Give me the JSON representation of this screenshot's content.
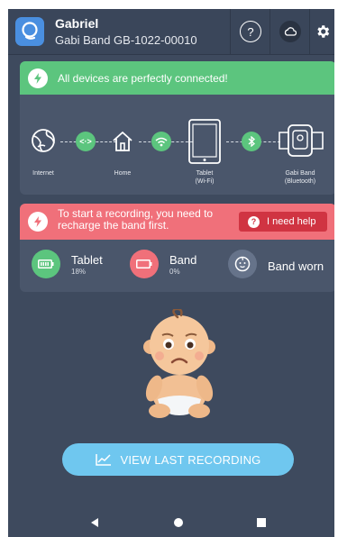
{
  "header": {
    "user_name": "Gabriel",
    "device_name": "Gabi Band GB-1022-00010",
    "help_icon": "question-circle-icon",
    "cloud_icon": "cloud-icon",
    "settings_icon": "gear-icon"
  },
  "connection": {
    "banner_text": "All devices are perfectly connected!",
    "nodes": [
      {
        "label": "Internet",
        "icon": "globe-icon"
      },
      {
        "label": "Home",
        "icon": "home-icon"
      },
      {
        "label": "Tablet\n(Wi-Fi)",
        "icon": "tablet-icon"
      },
      {
        "label": "Gabi Band\n(Bluetooth)",
        "icon": "band-icon"
      }
    ],
    "links": [
      "code-link-icon",
      "wifi-icon",
      "bluetooth-icon"
    ]
  },
  "status": {
    "banner_text": "To start a recording, you need to recharge the band first.",
    "help_button": "I need help",
    "tablet": {
      "label": "Tablet",
      "value": "18%"
    },
    "band": {
      "label": "Band",
      "value": "0%"
    },
    "worn": {
      "label": "Band worn"
    }
  },
  "main": {
    "view_button": "VIEW LAST RECORDING"
  },
  "colors": {
    "background": "#3e4a5e",
    "card": "#4a566b",
    "success": "#5cc57e",
    "alert": "#f0707a",
    "alert_button": "#d03442",
    "primary_button": "#6fc7ef"
  }
}
